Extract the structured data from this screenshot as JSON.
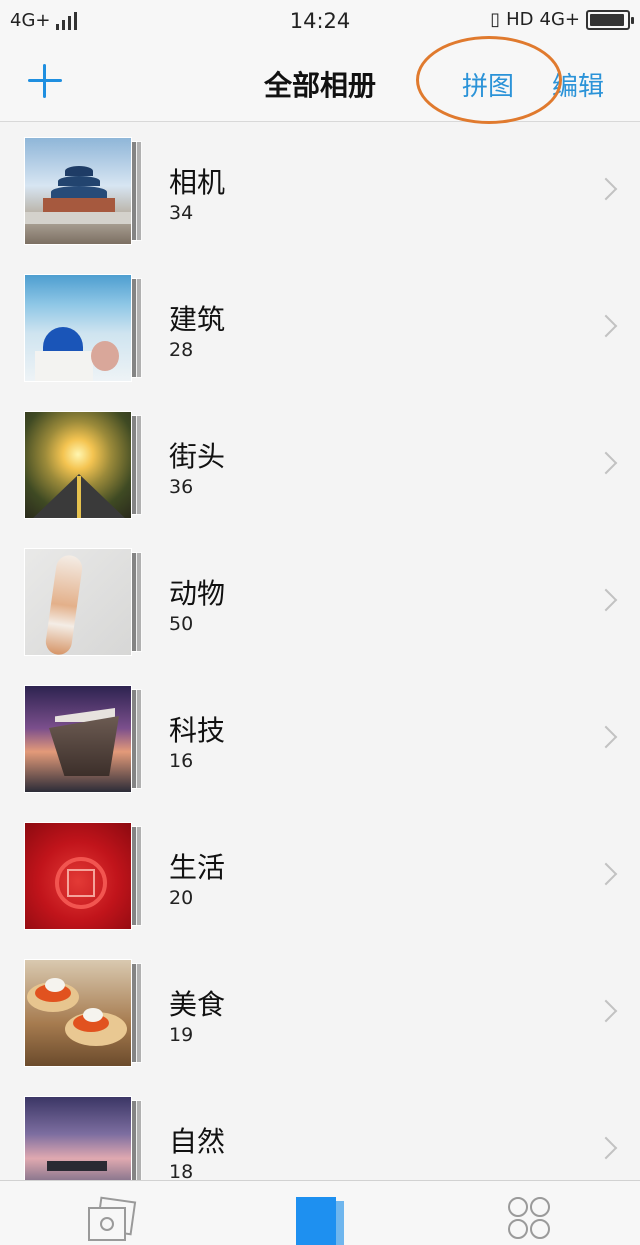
{
  "status_bar": {
    "network_left": "4G+",
    "time": "14:24",
    "hd": "HD",
    "network_right": "4G+",
    "battery_level": 0.95
  },
  "nav": {
    "title": "全部相册",
    "collage_label": "拼图",
    "edit_label": "编辑",
    "add_icon": "plus-icon",
    "accent_color": "#2b93d8"
  },
  "annotation": {
    "highlight_color": "#e07a2e"
  },
  "albums": [
    {
      "title": "相机",
      "count": "34"
    },
    {
      "title": "建筑",
      "count": "28"
    },
    {
      "title": "街头",
      "count": "36"
    },
    {
      "title": "动物",
      "count": "50"
    },
    {
      "title": "科技",
      "count": "16"
    },
    {
      "title": "生活",
      "count": "20"
    },
    {
      "title": "美食",
      "count": "19"
    },
    {
      "title": "自然",
      "count": "18"
    }
  ],
  "tabbar": {
    "tabs": [
      {
        "icon": "camera-photos-icon"
      },
      {
        "icon": "albums-icon",
        "active": true
      },
      {
        "icon": "more-grid-icon"
      }
    ],
    "active_color": "#1e90f0"
  }
}
